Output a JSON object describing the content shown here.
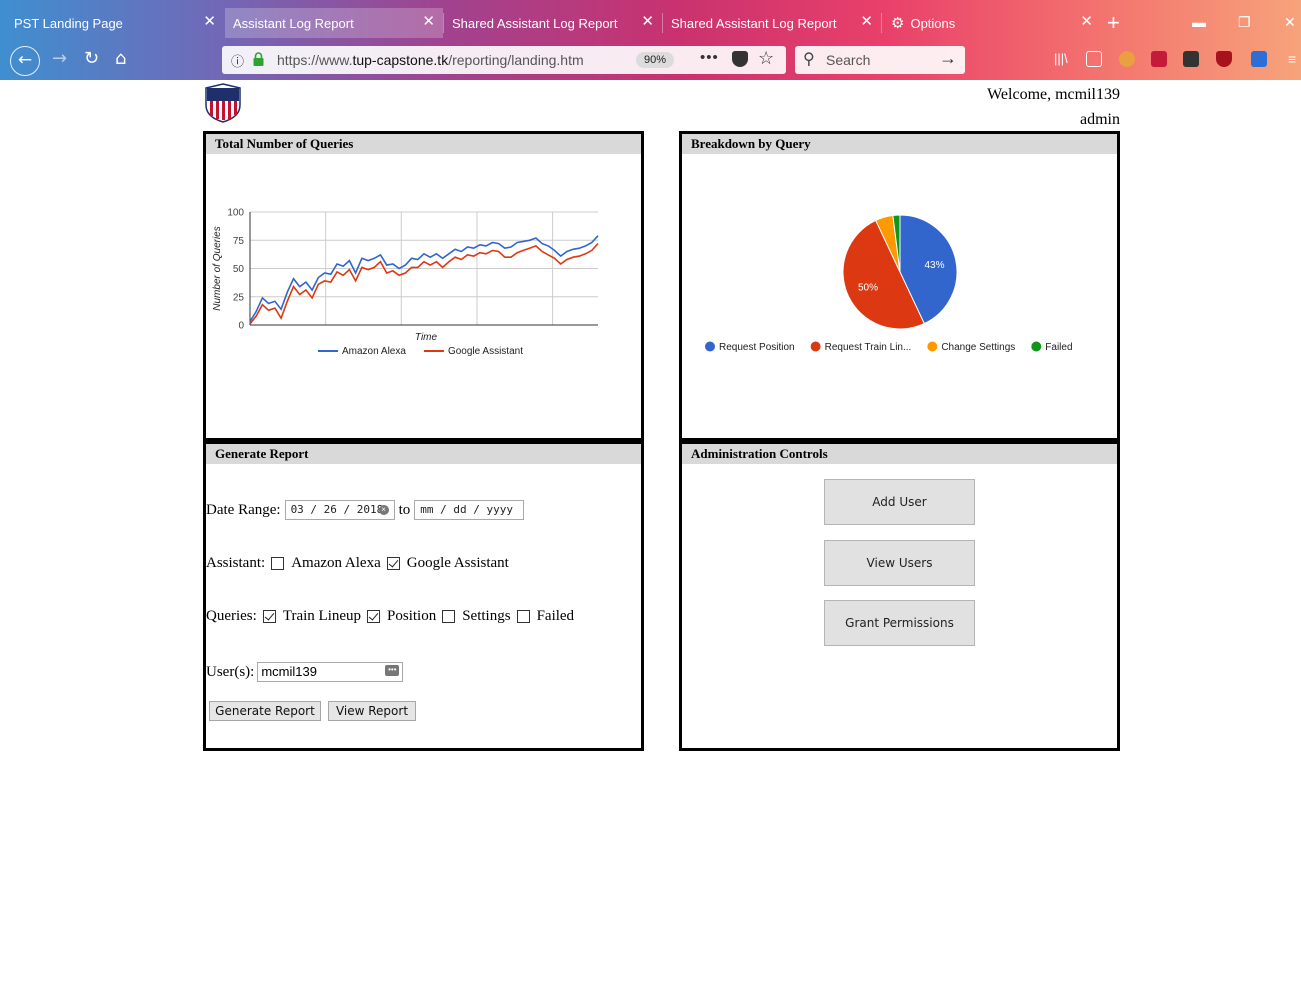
{
  "browser": {
    "tabs": [
      {
        "label": "PST Landing Page"
      },
      {
        "label": "Assistant Log Report"
      },
      {
        "label": "Shared Assistant Log Report"
      },
      {
        "label": "Shared Assistant Log Report"
      },
      {
        "label": "Options"
      }
    ],
    "url_prefix": "https://www.",
    "url_domain": "tup-capstone.tk",
    "url_path": "/reporting/landing.htm",
    "zoom": "90%",
    "search_placeholder": "Search"
  },
  "header": {
    "welcome": "Welcome, mcmil139",
    "role": "admin"
  },
  "queries_panel": {
    "title": "Total Number of Queries"
  },
  "breakdown_panel": {
    "title": "Breakdown by Query"
  },
  "report_panel": {
    "title": "Generate Report",
    "date_range_label": "Date Range:",
    "date_from": "03 / 26 / 2018",
    "date_to_label": "to",
    "date_to": "mm / dd / yyyy",
    "assistant_label": "Assistant:",
    "assistants": [
      {
        "label": "Amazon Alexa",
        "checked": false
      },
      {
        "label": "Google Assistant",
        "checked": true
      }
    ],
    "queries_label": "Queries:",
    "queries": [
      {
        "label": "Train Lineup",
        "checked": true
      },
      {
        "label": "Position",
        "checked": true
      },
      {
        "label": "Settings",
        "checked": false
      },
      {
        "label": "Failed",
        "checked": false
      }
    ],
    "users_label": "User(s):",
    "users_value": "mcmil139",
    "generate_label": "Generate Report",
    "view_label": "View Report"
  },
  "admin_panel": {
    "title": "Administration Controls",
    "buttons": [
      "Add User",
      "View Users",
      "Grant Permissions"
    ]
  },
  "chart_data": [
    {
      "type": "line",
      "xlabel": "Time",
      "ylabel": "Number of Queries",
      "ylim": [
        0,
        100
      ],
      "yticks": [
        "0",
        "25",
        "50",
        "75",
        "100"
      ],
      "legend": "bottom",
      "series": [
        {
          "name": "Amazon Alexa",
          "color": "#3366cc",
          "values": [
            3,
            12,
            24,
            19,
            21,
            14,
            29,
            41,
            34,
            38,
            31,
            42,
            46,
            45,
            54,
            52,
            57,
            46,
            59,
            57,
            59,
            62,
            53,
            54,
            50,
            53,
            59,
            58,
            63,
            60,
            63,
            59,
            63,
            67,
            65,
            69,
            68,
            71,
            70,
            73,
            72,
            68,
            69,
            73,
            74,
            75,
            77,
            72,
            70,
            66,
            61,
            65,
            67,
            68,
            70,
            73,
            79
          ]
        },
        {
          "name": "Google Assistant",
          "color": "#dc3912",
          "values": [
            1,
            8,
            18,
            13,
            15,
            6,
            21,
            34,
            27,
            31,
            24,
            36,
            39,
            38,
            47,
            44,
            49,
            39,
            51,
            49,
            51,
            56,
            46,
            48,
            44,
            46,
            51,
            51,
            56,
            53,
            56,
            51,
            56,
            60,
            58,
            62,
            61,
            64,
            63,
            66,
            65,
            60,
            60,
            64,
            66,
            68,
            70,
            65,
            62,
            59,
            54,
            58,
            60,
            61,
            63,
            66,
            72
          ]
        }
      ]
    },
    {
      "type": "pie",
      "legend": "bottom",
      "categories": [
        "Request Position",
        "Request Train Lin...",
        "Change Settings",
        "Failed"
      ],
      "values": [
        43,
        50,
        5,
        2
      ],
      "labels": [
        "43%",
        "50%",
        "",
        ""
      ],
      "colors": [
        "#3366cc",
        "#dc3912",
        "#ff9900",
        "#109618"
      ]
    }
  ]
}
